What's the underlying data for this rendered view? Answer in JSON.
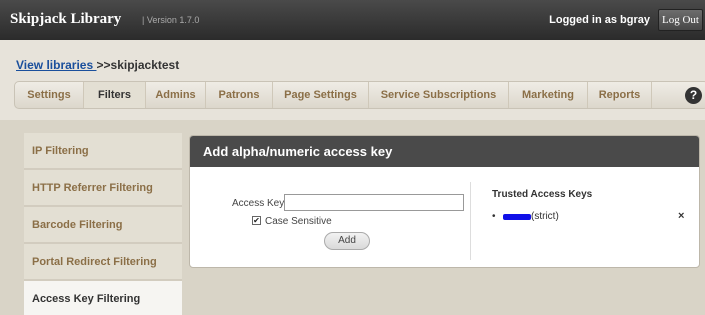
{
  "app": {
    "title": "Skipjack Library",
    "version": "| Version 1.7.0"
  },
  "header": {
    "logged_in": "Logged in as bgray",
    "logout_label": "Log Out"
  },
  "breadcrumb": {
    "link": "View libraries ",
    "sep": ">>",
    "current": "skipjacktest"
  },
  "tabs": [
    {
      "label": "Settings"
    },
    {
      "label": "Filters"
    },
    {
      "label": "Admins"
    },
    {
      "label": "Patrons"
    },
    {
      "label": "Page Settings"
    },
    {
      "label": "Service Subscriptions"
    },
    {
      "label": "Marketing"
    },
    {
      "label": "Reports"
    }
  ],
  "help_label": "?",
  "nav": [
    {
      "label": "IP Filtering"
    },
    {
      "label": "HTTP Referrer Filtering"
    },
    {
      "label": "Barcode Filtering"
    },
    {
      "label": "Portal Redirect Filtering"
    },
    {
      "label": "Access Key Filtering"
    }
  ],
  "panel": {
    "title": "Add alpha/numeric access key",
    "access_key_label": "Access Key:",
    "access_key_value": "",
    "case_sensitive_label": "Case Sensitive",
    "case_sensitive_checked": true,
    "add_label": "Add",
    "trusted_title": "Trusted Access Keys",
    "keys": [
      {
        "text": "(strict)",
        "remove": "×"
      }
    ]
  },
  "colors": {
    "accent": "#8b6f47",
    "header_bg": "#2b2b2b",
    "link": "#1a4f9c"
  }
}
